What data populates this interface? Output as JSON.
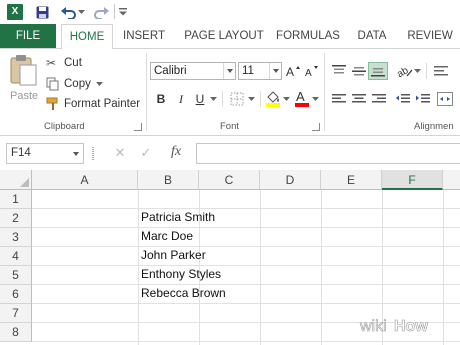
{
  "app": {
    "logo_text": "X"
  },
  "qat": {
    "icons": [
      "excel-logo",
      "save-icon",
      "undo-icon",
      "redo-icon",
      "customize-icon"
    ]
  },
  "tabs": [
    {
      "label": "FILE"
    },
    {
      "label": "HOME"
    },
    {
      "label": "INSERT"
    },
    {
      "label": "PAGE LAYOUT"
    },
    {
      "label": "FORMULAS"
    },
    {
      "label": "DATA"
    },
    {
      "label": "REVIEW"
    }
  ],
  "ribbon": {
    "clipboard": {
      "paste_label": "Paste",
      "cut_label": "Cut",
      "copy_label": "Copy",
      "format_painter_label": "Format Painter",
      "group_label": "Clipboard"
    },
    "font": {
      "font_name": "Calibri",
      "font_size": "11",
      "bold": "B",
      "italic": "I",
      "underline": "U",
      "group_label": "Font",
      "highlight_color": "#ffff00",
      "font_color": "#ff0000"
    },
    "alignment": {
      "group_label": "Alignmen"
    }
  },
  "formula_bar": {
    "name_box": "F14",
    "fx_label": "fx",
    "value": ""
  },
  "grid": {
    "columns": [
      "A",
      "B",
      "C",
      "D",
      "E",
      "F"
    ],
    "selected_column": "F",
    "rows": [
      "1",
      "2",
      "3",
      "4",
      "5",
      "6",
      "7",
      "8"
    ],
    "cells": [
      {
        "ref": "B2",
        "value": "Patricia Smith"
      },
      {
        "ref": "B3",
        "value": "Marc Doe"
      },
      {
        "ref": "B4",
        "value": "John Parker"
      },
      {
        "ref": "B5",
        "value": "Enthony Styles"
      },
      {
        "ref": "B6",
        "value": "Rebecca Brown"
      }
    ]
  },
  "watermark": {
    "wiki": "wiki",
    "how": "How"
  },
  "colors": {
    "accent": "#217346"
  }
}
